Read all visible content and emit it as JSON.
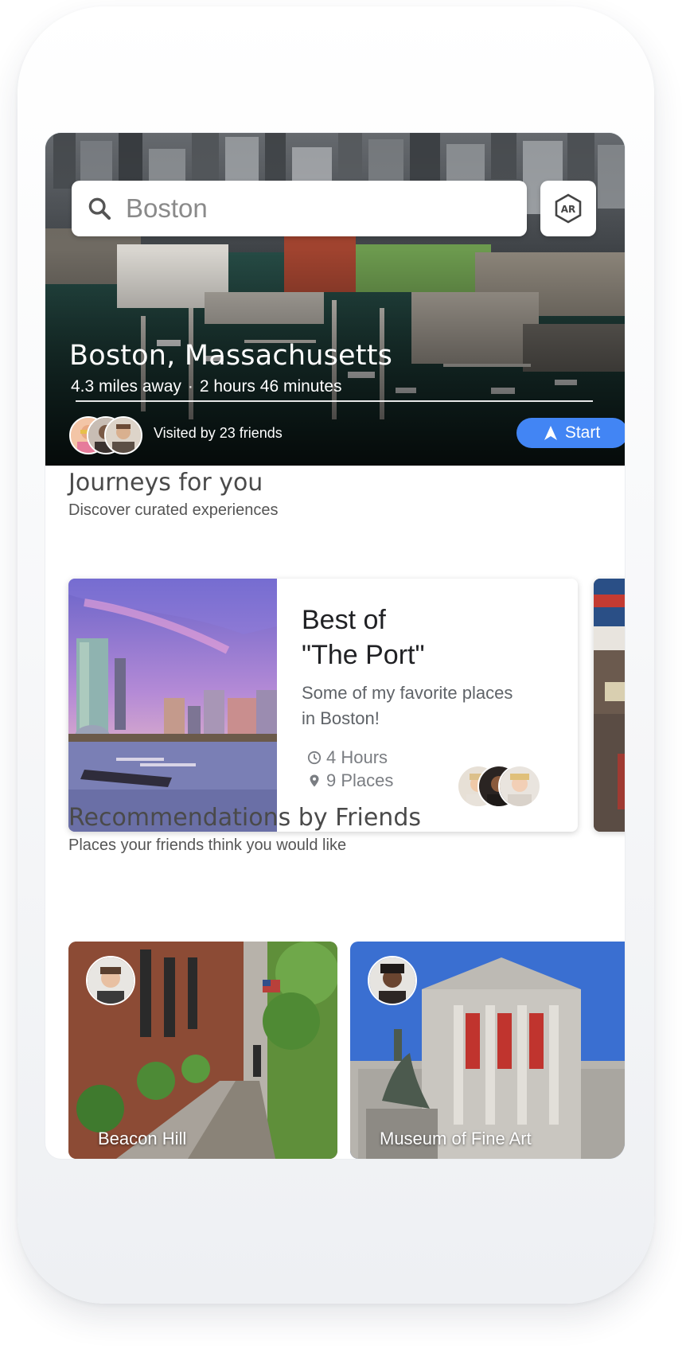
{
  "search": {
    "query": "Boston"
  },
  "ar_button": {
    "label": "AR"
  },
  "hero": {
    "title": "Boston, Massachusetts",
    "distance": "4.3 miles away",
    "separator": "·",
    "duration": "2 hours 46 minutes",
    "visited": "Visited by 23 friends",
    "start_label": "Start"
  },
  "journeys": {
    "title": "Journeys for you",
    "subtitle": "Discover curated experiences",
    "card": {
      "title_line1": "Best of",
      "title_line2": "\"The Port\"",
      "desc_line1": "Some of my favorite places",
      "desc_line2": "in Boston!",
      "hours": "4 Hours",
      "places": "9 Places"
    }
  },
  "recommendations": {
    "title": "Recommendations by Friends",
    "subtitle": "Places your friends think you would like",
    "items": [
      {
        "label": "Beacon Hill"
      },
      {
        "label": "Museum of Fine Art"
      }
    ]
  },
  "colors": {
    "accent": "#4285f4",
    "title_text": "#4a4a4a",
    "body_text": "#5f6368"
  },
  "icons": [
    "search-icon",
    "ar-icon",
    "navigation-arrow-icon",
    "clock-icon",
    "pin-icon"
  ]
}
